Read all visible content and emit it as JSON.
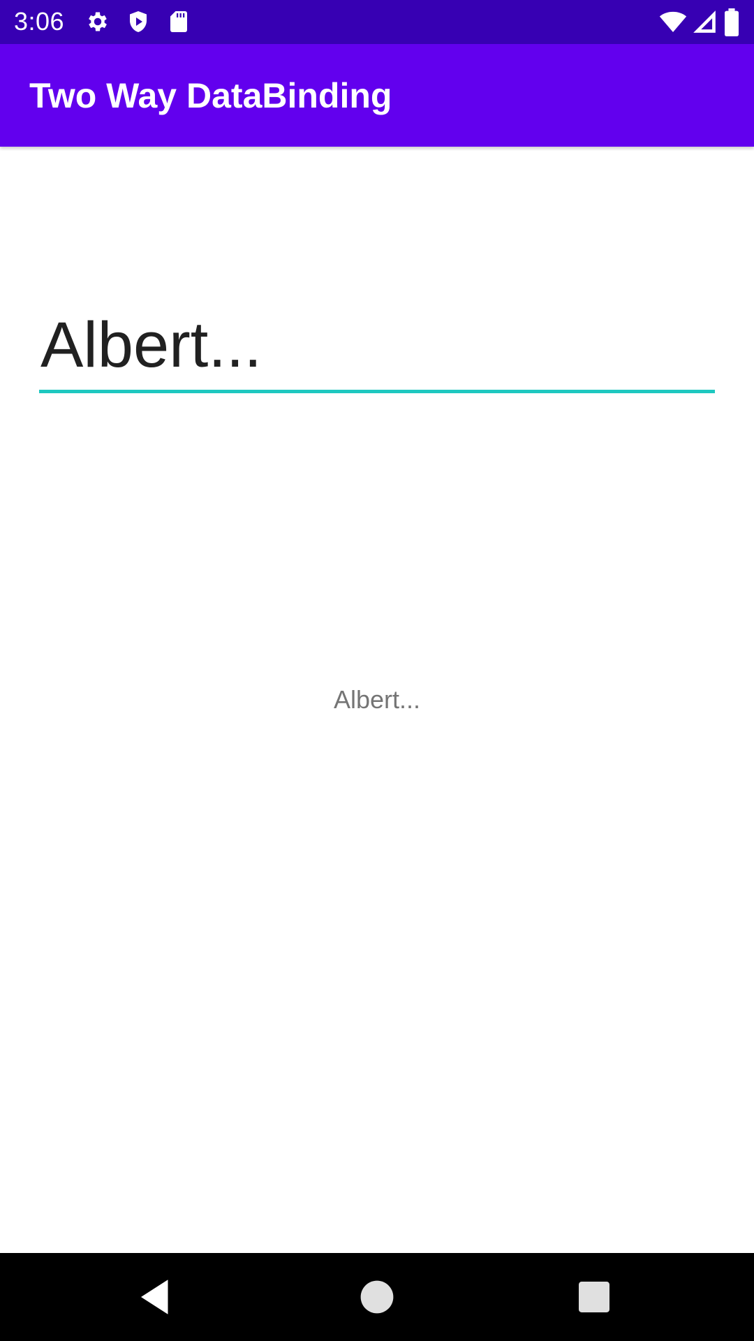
{
  "status_bar": {
    "time": "3:06",
    "background": "#3700b3",
    "left_icons": [
      "gear-icon",
      "shield-icon",
      "sd-card-icon"
    ],
    "right_icons": [
      "wifi-icon",
      "cell-signal-icon",
      "battery-icon"
    ]
  },
  "app_bar": {
    "title": "Two Way DataBinding",
    "background": "#6200ee"
  },
  "edit_field": {
    "value": "Albert...",
    "underline_color": "#1ec8c0"
  },
  "mirror_label": {
    "text": "Albert..."
  },
  "nav_bar": {
    "buttons": [
      "back-icon",
      "home-icon",
      "recents-icon"
    ]
  }
}
